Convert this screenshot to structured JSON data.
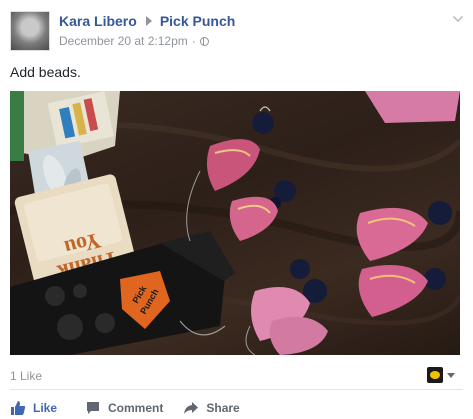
{
  "post": {
    "author": "Kara Libero",
    "target": "Pick Punch",
    "timestamp": "December 20 at 2:12pm",
    "separator": "·",
    "status": "Add beads."
  },
  "photo": {
    "card_text_top": "Thank",
    "card_text_bottom": "You",
    "device_label_1": "Pick",
    "device_label_2": "Punch"
  },
  "stats": {
    "likes": "1 Like"
  },
  "actions": {
    "like": "Like",
    "comment": "Comment",
    "share": "Share"
  },
  "colors": {
    "link": "#365899",
    "like_blue": "#4267b2",
    "muted": "#90949c",
    "pick_orange": "#e0661f"
  },
  "icons": [
    "chevron-down-icon",
    "globe-icon",
    "thumbs-up-icon",
    "comment-icon",
    "share-icon",
    "page-avatar-icon"
  ]
}
